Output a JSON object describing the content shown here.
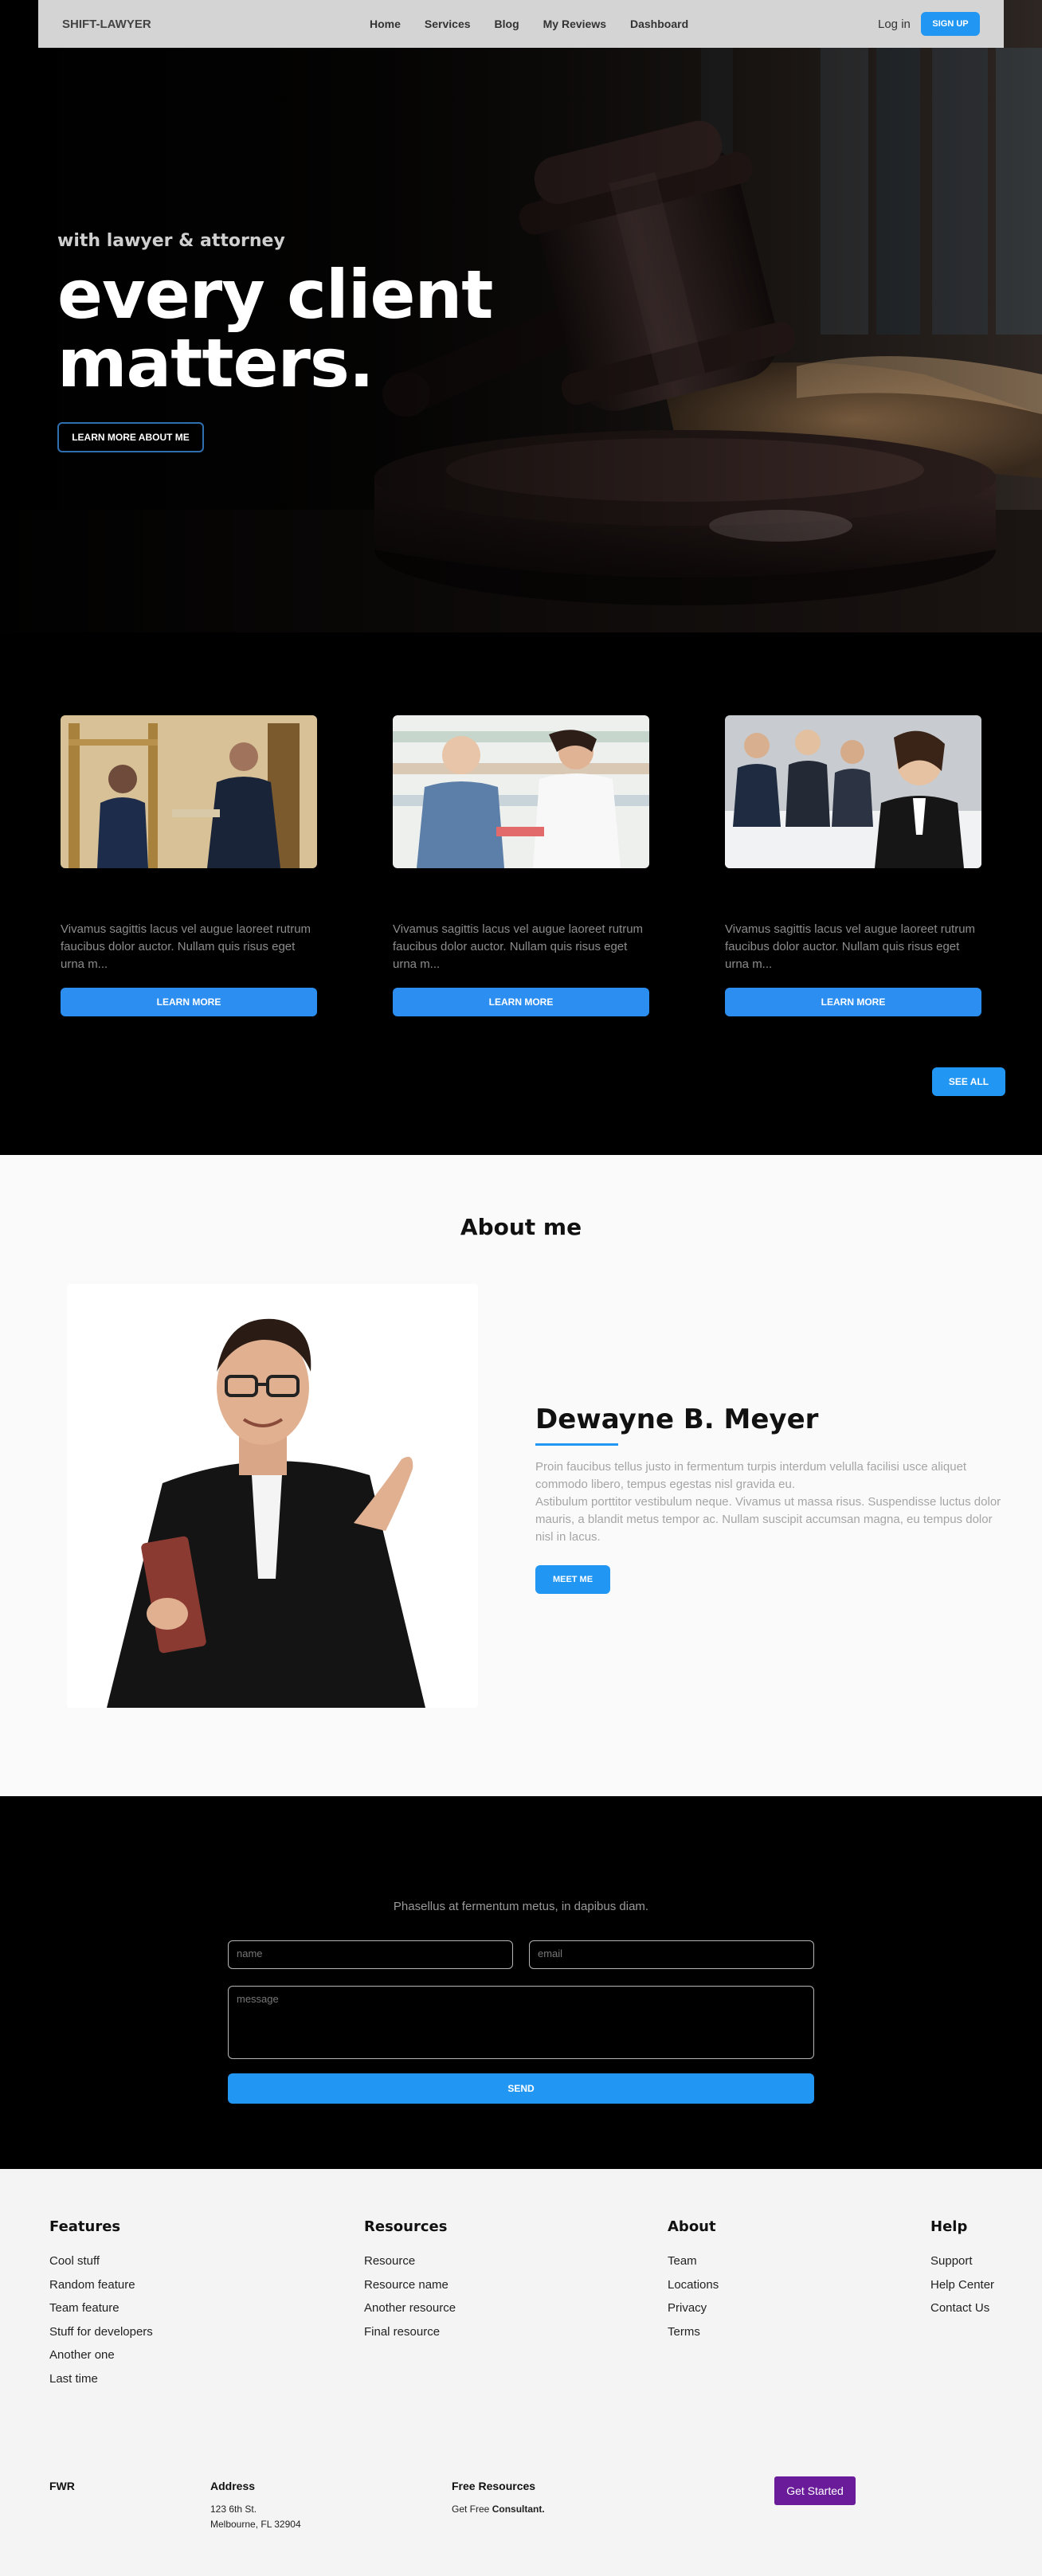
{
  "nav": {
    "brand": "SHIFT-LAWYER",
    "links": [
      "Home",
      "Services",
      "Blog",
      "My Reviews",
      "Dashboard"
    ],
    "login": "Log in",
    "signup": "SIGN UP"
  },
  "hero": {
    "subtitle": "with lawyer & attorney",
    "title_line1": "every client",
    "title_line2": "matters.",
    "button": "LEARN MORE ABOUT ME"
  },
  "cards": {
    "items": [
      {
        "text": "Vivamus sagittis lacus vel augue laoreet rutrum faucibus dolor auctor. Nullam quis risus eget urna m...",
        "button": "LEARN MORE"
      },
      {
        "text": "Vivamus sagittis lacus vel augue laoreet rutrum faucibus dolor auctor. Nullam quis risus eget urna m...",
        "button": "LEARN MORE"
      },
      {
        "text": "Vivamus sagittis lacus vel augue laoreet rutrum faucibus dolor auctor. Nullam quis risus eget urna m...",
        "button": "LEARN MORE"
      }
    ],
    "see_all": "SEE ALL"
  },
  "about": {
    "title": "About me",
    "name": "Dewayne B. Meyer",
    "desc1": "Proin faucibus tellus justo in fermentum turpis interdum velulla facilisi usce aliquet commodo libero, tempus egestas nisl gravida eu.",
    "desc2": "Astibulum porttitor vestibulum neque. Vivamus ut massa risus. Suspendisse luctus dolor mauris, a blandit metus tempor ac. Nullam suscipit accumsan magna, eu tempus dolor nisl in lacus.",
    "button": "MEET ME"
  },
  "contact": {
    "lead": "Phasellus at fermentum metus, in dapibus diam.",
    "name_placeholder": "name",
    "email_placeholder": "email",
    "message_placeholder": "message",
    "send": "SEND"
  },
  "footer": {
    "columns": [
      {
        "title": "Features",
        "items": [
          "Cool stuff",
          "Random feature",
          "Team feature",
          "Stuff for developers",
          "Another one",
          "Last time"
        ]
      },
      {
        "title": "Resources",
        "items": [
          "Resource",
          "Resource name",
          "Another resource",
          "Final resource"
        ]
      },
      {
        "title": "About",
        "items": [
          "Team",
          "Locations",
          "Privacy",
          "Terms"
        ]
      },
      {
        "title": "Help",
        "items": [
          "Support",
          "Help Center",
          "Contact Us"
        ]
      }
    ],
    "brand": "FWR",
    "address_title": "Address",
    "address_line1": "123 6th St.",
    "address_line2": "Melbourne, FL 32904",
    "free_title": "Free Resources",
    "free_text": "Get Free",
    "free_bold": "Consultant.",
    "get_started": "Get Started"
  },
  "colors": {
    "accent": "#2196f3",
    "purple": "#6a1b9a"
  }
}
